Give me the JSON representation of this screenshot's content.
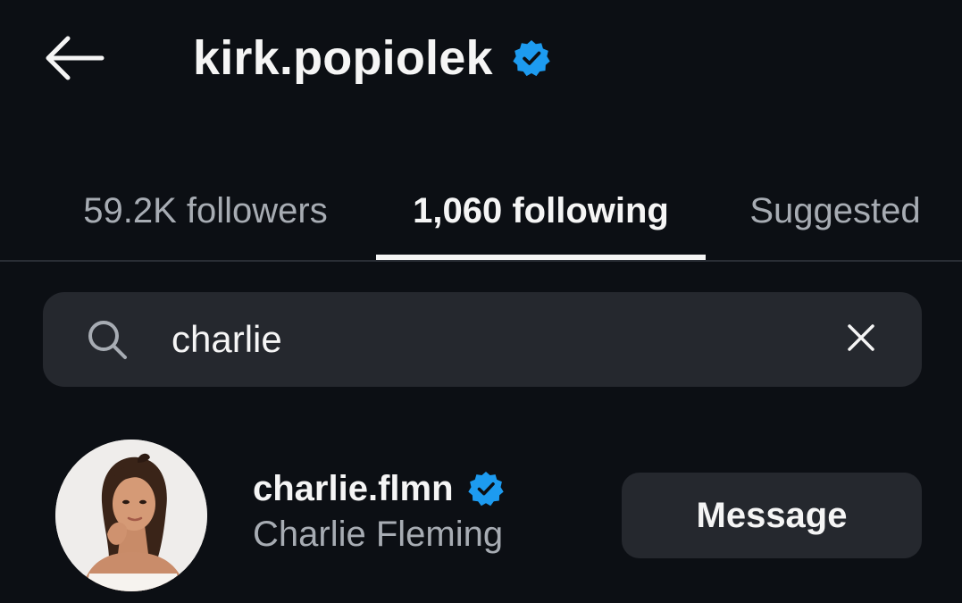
{
  "header": {
    "title": "kirk.popiolek",
    "verified": true,
    "back_icon": "arrow-left-icon"
  },
  "tabs": [
    {
      "label": "59.2K followers",
      "active": false
    },
    {
      "label": "1,060 following",
      "active": true
    },
    {
      "label": "Suggested",
      "active": false
    }
  ],
  "search": {
    "value": "charlie",
    "icon": "search-icon",
    "clear_icon": "close-icon"
  },
  "results": [
    {
      "username": "charlie.flmn",
      "full_name": "Charlie Fleming",
      "verified": true,
      "button_label": "Message"
    }
  ],
  "colors": {
    "background": "#0c0f14",
    "surface": "#25282e",
    "verified_blue": "#1d9bf0",
    "text_primary": "#f5f5f5",
    "text_secondary": "#a7acb3"
  }
}
